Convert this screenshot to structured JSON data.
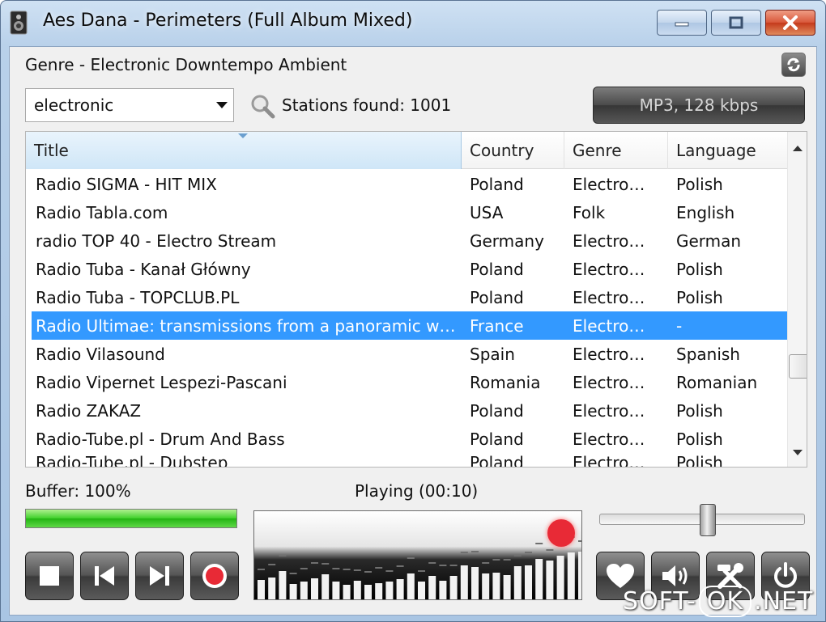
{
  "window": {
    "title": "Aes Dana - Perimeters (Full Album Mixed)"
  },
  "genre_line": "Genre - Electronic Downtempo Ambient",
  "search": {
    "genre_filter": "electronic",
    "stations_found": "Stations found: 1001"
  },
  "format_button": "MP3, 128 kbps",
  "list": {
    "columns": [
      "Title",
      "Country",
      "Genre",
      "Language"
    ],
    "rows": [
      {
        "title": "Radio SIGMA - HIT MIX",
        "country": "Poland",
        "genre": "Electro…",
        "language": "Polish"
      },
      {
        "title": "Radio Tabla.com",
        "country": "USA",
        "genre": "Folk",
        "language": "English"
      },
      {
        "title": "radio TOP 40 - Electro Stream",
        "country": "Germany",
        "genre": "Electro…",
        "language": "German"
      },
      {
        "title": "Radio Tuba - Kanał Główny",
        "country": "Poland",
        "genre": "Electro…",
        "language": "Polish"
      },
      {
        "title": "Radio Tuba - TOPCLUB.PL",
        "country": "Poland",
        "genre": "Electro…",
        "language": "Polish"
      },
      {
        "title": "Radio Ultimae: transmissions from a panoramic w…",
        "country": "France",
        "genre": "Electro…",
        "language": "-"
      },
      {
        "title": "Radio Vilasound",
        "country": "Spain",
        "genre": "Electro…",
        "language": "Spanish"
      },
      {
        "title": "Radio Vipernet Lespezi-Pascani",
        "country": "Romania",
        "genre": "Electro…",
        "language": "Romanian"
      },
      {
        "title": "Radio ZAKAZ",
        "country": "Poland",
        "genre": "Electro…",
        "language": "Polish"
      },
      {
        "title": "Radio-Tube.pl - Drum And Bass",
        "country": "Poland",
        "genre": "Electro…",
        "language": "Polish"
      },
      {
        "title": "Radio-Tube.pl - Dubstep",
        "country": "Poland",
        "genre": "Electro…",
        "language": "Polish"
      }
    ],
    "selected_index": 5
  },
  "status": {
    "buffer": "Buffer: 100%",
    "buffer_fraction": 1.0,
    "playing": "Playing (00:10)"
  },
  "volume_level": 0.53,
  "spectrum_levels": [
    0.26,
    0.29,
    0.37,
    0.21,
    0.24,
    0.28,
    0.33,
    0.24,
    0.2,
    0.25,
    0.2,
    0.22,
    0.24,
    0.27,
    0.34,
    0.24,
    0.31,
    0.25,
    0.31,
    0.44,
    0.42,
    0.34,
    0.35,
    0.32,
    0.43,
    0.44,
    0.52,
    0.5,
    0.56,
    0.6,
    0.61,
    0.54
  ],
  "watermark": {
    "left": "SOFT-",
    "ok": "OK",
    "right": ".NET"
  },
  "icons": {
    "app": "speaker-icon",
    "refresh": "refresh-icon",
    "search": "magnifier-icon",
    "stop": "stop-icon",
    "prev": "previous-icon",
    "next": "next-icon",
    "record": "record-icon",
    "favorite": "heart-icon",
    "volume": "speaker-volume-icon",
    "settings": "tools-icon",
    "power": "power-icon"
  },
  "colors": {
    "selection": "#3399ff",
    "record": "#e82a36",
    "buffer": "#3fcf2a"
  }
}
